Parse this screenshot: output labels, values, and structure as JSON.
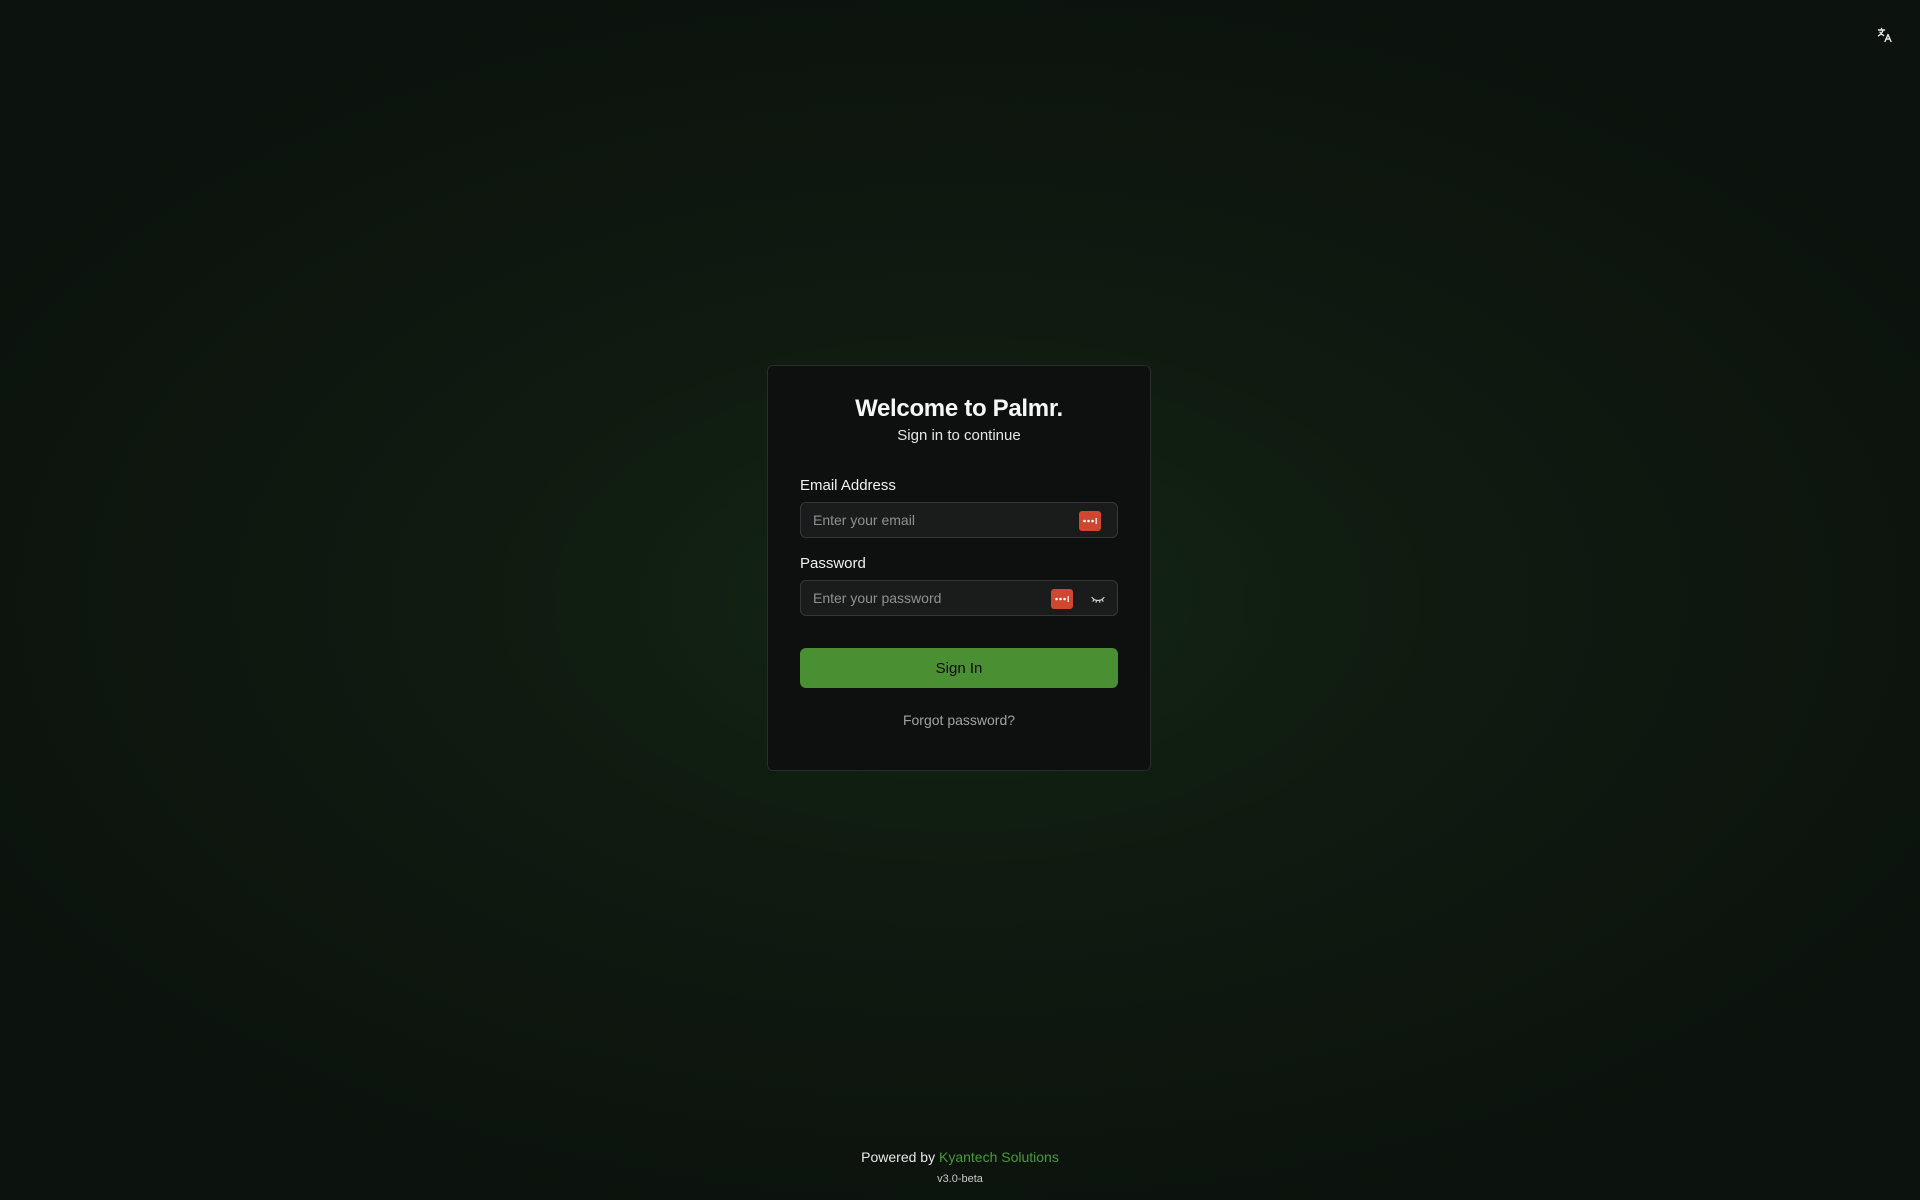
{
  "header": {
    "language_icon": "translate-icon"
  },
  "login": {
    "title": "Welcome to Palmr.",
    "subtitle": "Sign in to continue",
    "email": {
      "label": "Email Address",
      "placeholder": "Enter your email",
      "value": "",
      "autofill_icon": "password-manager-icon"
    },
    "password": {
      "label": "Password",
      "placeholder": "Enter your password",
      "value": "",
      "autofill_icon": "password-manager-icon",
      "toggle_icon": "eye-closed-icon"
    },
    "sign_in_label": "Sign In",
    "forgot_label": "Forgot password?"
  },
  "footer": {
    "powered_prefix": "Powered by",
    "powered_link": "Kyantech Solutions",
    "version": "v3.0-beta"
  },
  "colors": {
    "accent": "#4a8f32",
    "link": "#4a9a3a",
    "autofill": "#d0472f",
    "card_bg": "#0d100e"
  }
}
